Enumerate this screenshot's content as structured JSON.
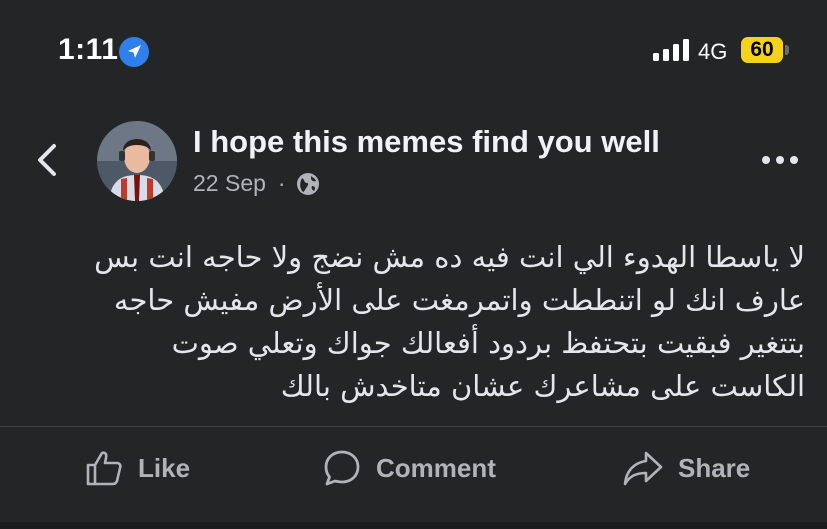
{
  "status_bar": {
    "time": "1:11",
    "network": "4G",
    "battery": "60",
    "icons": [
      "location-arrow-icon",
      "signal-bars-icon"
    ]
  },
  "header": {
    "back_icon": "chevron-left-icon",
    "title": "I hope this memes find you well",
    "date": "22 Sep",
    "separator": "·",
    "privacy_icon": "globe-icon",
    "more_icon": "ellipsis-icon"
  },
  "post": {
    "lines": [
      "لا ياسطا الهدوء الي انت فيه ده مش نضج ولا حاجه انت بس",
      "عارف انك لو اتنططت واتمرمغت على الأرض مفيش حاجه",
      "بتتغير فبقيت بتحتفظ بردود أفعالك جواك وتعلي صوت",
      "الكاست على مشاعرك عشان متاخدش بالك"
    ]
  },
  "actions": {
    "like": "Like",
    "comment": "Comment",
    "share": "Share"
  },
  "colors": {
    "background": "#242526",
    "text": "#e4e6eb",
    "muted": "#b0b3b8",
    "battery": "#f7d21a",
    "location": "#2f80ed"
  }
}
